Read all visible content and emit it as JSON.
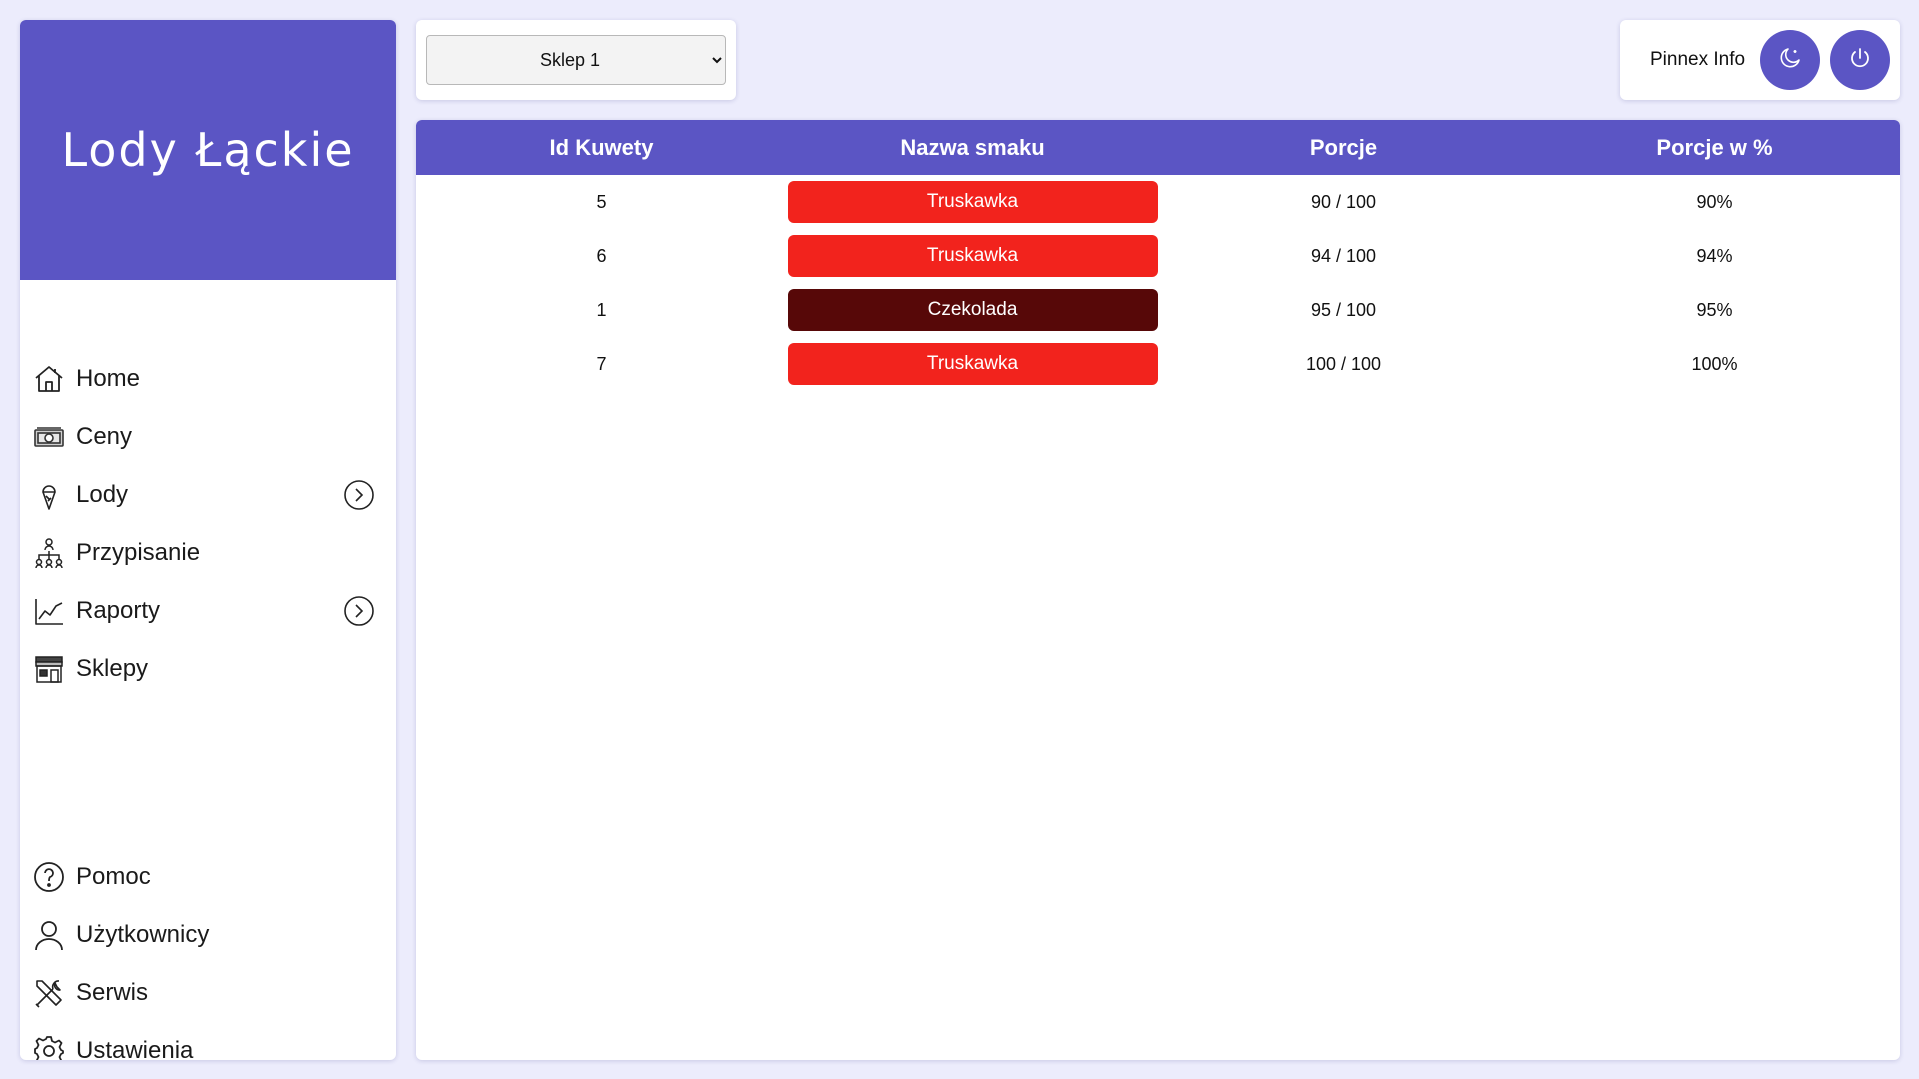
{
  "sidebar": {
    "brand": "Lody Łąckie",
    "nav_items": [
      {
        "label": "Home",
        "icon": "home-icon",
        "expandable": false
      },
      {
        "label": "Ceny",
        "icon": "money-icon",
        "expandable": false
      },
      {
        "label": "Lody",
        "icon": "ice-cream-icon",
        "expandable": true
      },
      {
        "label": "Przypisanie",
        "icon": "hierarchy-icon",
        "expandable": false
      },
      {
        "label": "Raporty",
        "icon": "chart-line-icon",
        "expandable": true
      },
      {
        "label": "Sklepy",
        "icon": "store-icon",
        "expandable": false
      }
    ],
    "bottom_items": [
      {
        "label": "Pomoc",
        "icon": "help-icon"
      },
      {
        "label": "Użytkownicy",
        "icon": "user-icon"
      },
      {
        "label": "Serwis",
        "icon": "tools-icon"
      },
      {
        "label": "Ustawienia",
        "icon": "gear-icon"
      }
    ]
  },
  "store_select": {
    "selected": "Sklep 1"
  },
  "user": {
    "name": "Pinnex Info",
    "theme_icon": "moon-icon",
    "logout_icon": "power-icon"
  },
  "table": {
    "columns": [
      "Id Kuwety",
      "Nazwa smaku",
      "Porcje",
      "Porcje w %"
    ],
    "rows": [
      {
        "id": "5",
        "flavor": "Truskawka",
        "flavor_color": "#f2231d",
        "portions": "90 / 100",
        "percent": "90%"
      },
      {
        "id": "6",
        "flavor": "Truskawka",
        "flavor_color": "#f2231d",
        "portions": "94 / 100",
        "percent": "94%"
      },
      {
        "id": "1",
        "flavor": "Czekolada",
        "flavor_color": "#570808",
        "portions": "95 / 100",
        "percent": "95%"
      },
      {
        "id": "7",
        "flavor": "Truskawka",
        "flavor_color": "#f2231d",
        "portions": "100 / 100",
        "percent": "100%"
      }
    ]
  },
  "colors": {
    "accent": "#5b55c4",
    "background": "#ececfc"
  }
}
